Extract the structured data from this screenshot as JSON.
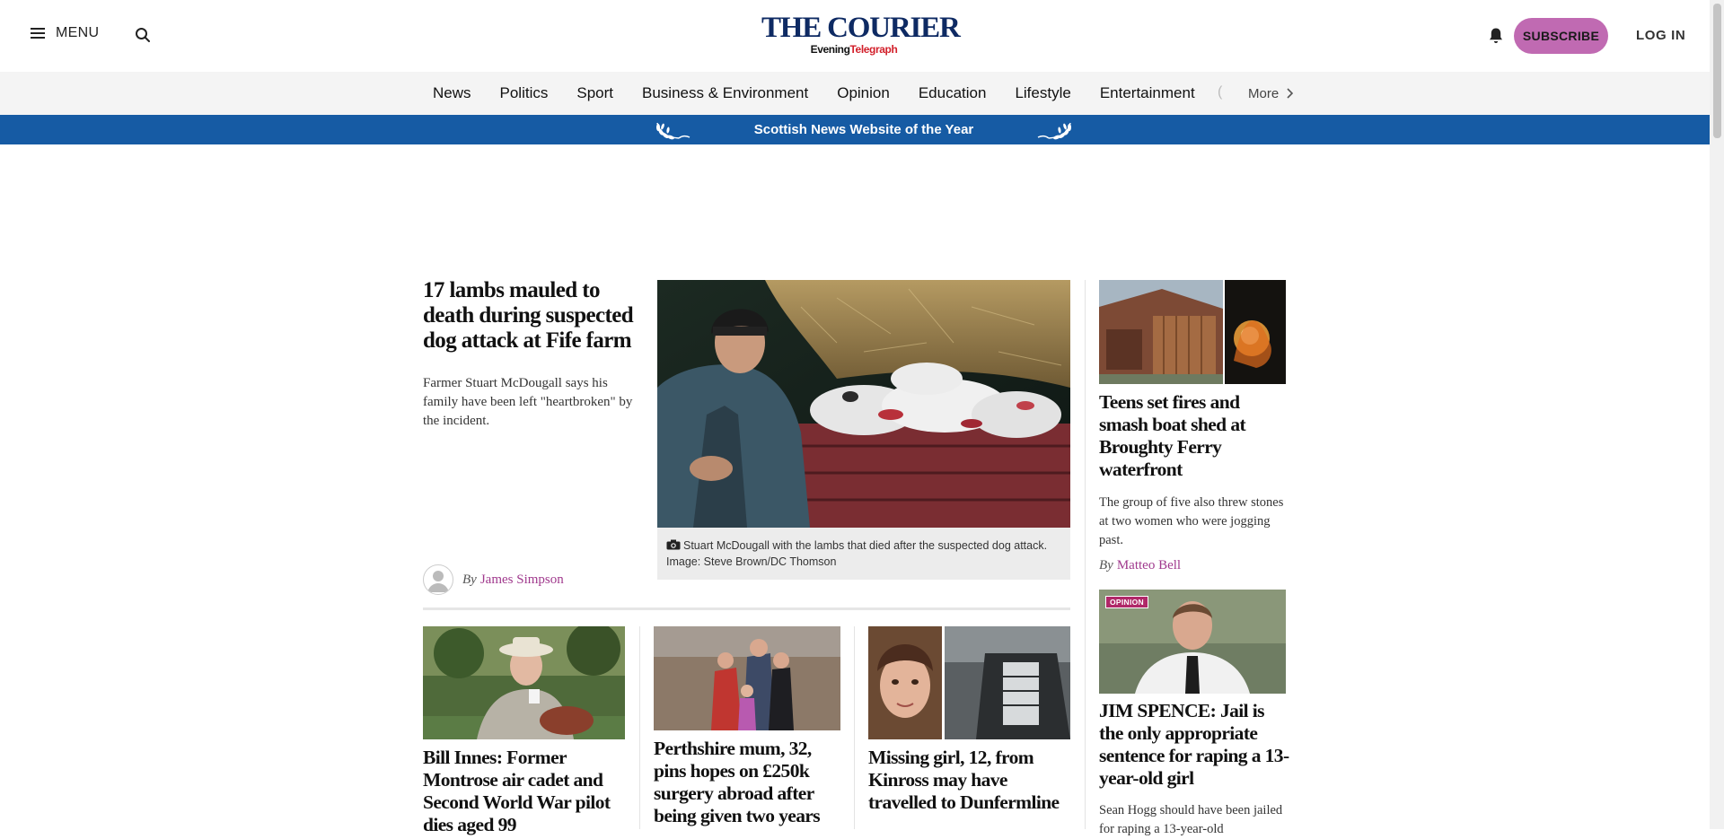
{
  "header": {
    "menu_label": "MENU",
    "logo_main": "THE COURIER",
    "logo_sub_a": "Evening",
    "logo_sub_b": "Telegraph",
    "subscribe_label": "SUBSCRIBE",
    "login_label": "LOG IN",
    "icons": [
      "hamburger-icon",
      "search-icon",
      "bell-icon"
    ],
    "colors": {
      "logo_navy": "#0e2a63",
      "logo_red": "#d21f2a",
      "subscribe_bg": "#c06ab2"
    }
  },
  "nav": {
    "items": [
      "News",
      "Politics",
      "Sport",
      "Business & Environment",
      "Opinion",
      "Education",
      "Lifestyle",
      "Entertainment"
    ],
    "faded_glyph": "(",
    "more_label": "More"
  },
  "banner": {
    "text": "Scottish News Website of the Year",
    "color": "#165ba4"
  },
  "lead": {
    "headline": "17 lambs mauled to death during suspected dog attack at Fife farm",
    "standfirst": "Farmer Stuart McDougall says his family have been left \"heartbroken\" by the incident.",
    "byline_prefix": "By",
    "author": "James Simpson",
    "caption": "Stuart McDougall with the lambs that died after the suspected dog attack. Image: Steve Brown/DC Thomson"
  },
  "right_column": [
    {
      "headline": "Teens set fires and smash boat shed at Broughty Ferry waterfront",
      "standfirst": "The group of five also threw stones at two women who were jogging past.",
      "byline_prefix": "By",
      "author": "Matteo Bell"
    },
    {
      "badge": "OPINION",
      "headline": "JIM SPENCE: Jail is the only appropriate sentence for raping a 13-year-old girl",
      "standfirst": "Sean Hogg should have been jailed for raping a 13-year-old"
    }
  ],
  "bottom_stories": [
    {
      "headline": "Bill Innes: Former Montrose air cadet and Second World War pilot dies aged 99"
    },
    {
      "headline": "Perthshire mum, 32, pins hopes on £250k surgery abroad after being given two years"
    },
    {
      "headline": "Missing girl, 12, from Kinross may have travelled to Dunfermline"
    }
  ],
  "accent_author_color": "#a0398d"
}
